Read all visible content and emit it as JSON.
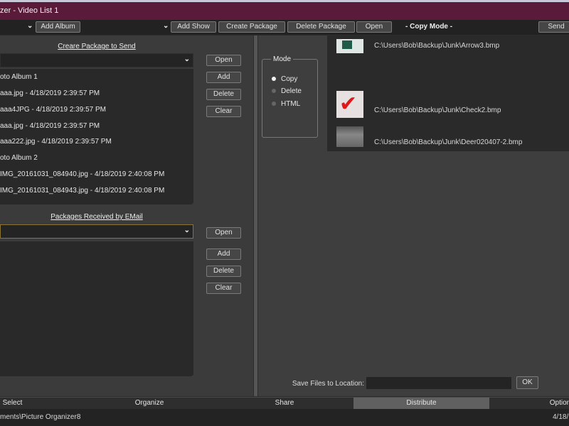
{
  "window": {
    "title": "zer - Video List 1"
  },
  "toolbar": {
    "add_album": "Add Album",
    "add_show": "Add Show",
    "create_package": "Create Package",
    "delete_package": "Delete Package",
    "open": "Open",
    "mode_label": "- Copy Mode -",
    "send": "Send"
  },
  "send_section": {
    "header": "Creare Package to Send",
    "open": "Open",
    "add": "Add",
    "delete": "Delete",
    "clear": "Clear",
    "items": [
      "oto Album 1",
      "aaa.jpg - 4/18/2019 2:39:57 PM",
      "aaa4JPG - 4/18/2019 2:39:57 PM",
      "aaa.jpg - 4/18/2019 2:39:57 PM",
      "aaa222.jpg - 4/18/2019 2:39:57 PM",
      "oto Album 2",
      "IMG_20161031_084940.jpg - 4/18/2019 2:40:08 PM",
      "IMG_20161031_084943.jpg - 4/18/2019 2:40:08 PM"
    ]
  },
  "received_section": {
    "header": "Packages Received by EMail",
    "open": "Open",
    "add": "Add",
    "delete": "Delete",
    "clear": "Clear"
  },
  "mode": {
    "label": "Mode",
    "options": [
      "Copy",
      "Delete",
      "HTML"
    ],
    "selected": "Copy"
  },
  "files": [
    "C:\\Users\\Bob\\Backup\\Junk\\Arrow3.bmp",
    "C:\\Users\\Bob\\Backup\\Junk\\Check2.bmp",
    "C:\\Users\\Bob\\Backup\\Junk\\Deer020407-2.bmp"
  ],
  "save": {
    "label": "Save Files to Location:",
    "value": "",
    "ok": "OK"
  },
  "tabs": [
    "Select",
    "Organize",
    "Share",
    "Distribute",
    "Options"
  ],
  "active_tab": "Distribute",
  "status": {
    "path": "ments\\Picture Organizer8",
    "date": "4/18/"
  }
}
